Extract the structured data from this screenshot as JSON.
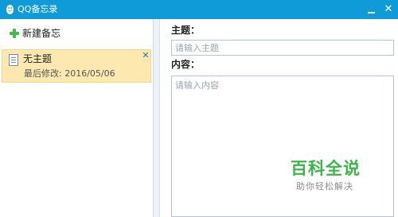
{
  "window": {
    "title": "QQ备忘录",
    "app_icon": "qq-penguin-icon",
    "controls": [
      "minimize-icon",
      "close-icon"
    ],
    "accent_color": "#0f9bd7"
  },
  "sidebar": {
    "new_memo_label": "新建备忘",
    "new_memo_icon": "plus-icon",
    "memos": [
      {
        "title": "无主题",
        "meta": "最后修改: 2016/05/06",
        "selected": true,
        "highlight_color": "#fde8b0"
      }
    ]
  },
  "editor": {
    "subject_label": "主题：",
    "subject_placeholder": "请输入主题",
    "subject_value": "",
    "content_label": "内容：",
    "content_placeholder": "请输入内容",
    "content_value": ""
  },
  "watermark": {
    "title": "百科全说",
    "subtitle": "助你轻松解决",
    "color": "#3bb54a"
  }
}
